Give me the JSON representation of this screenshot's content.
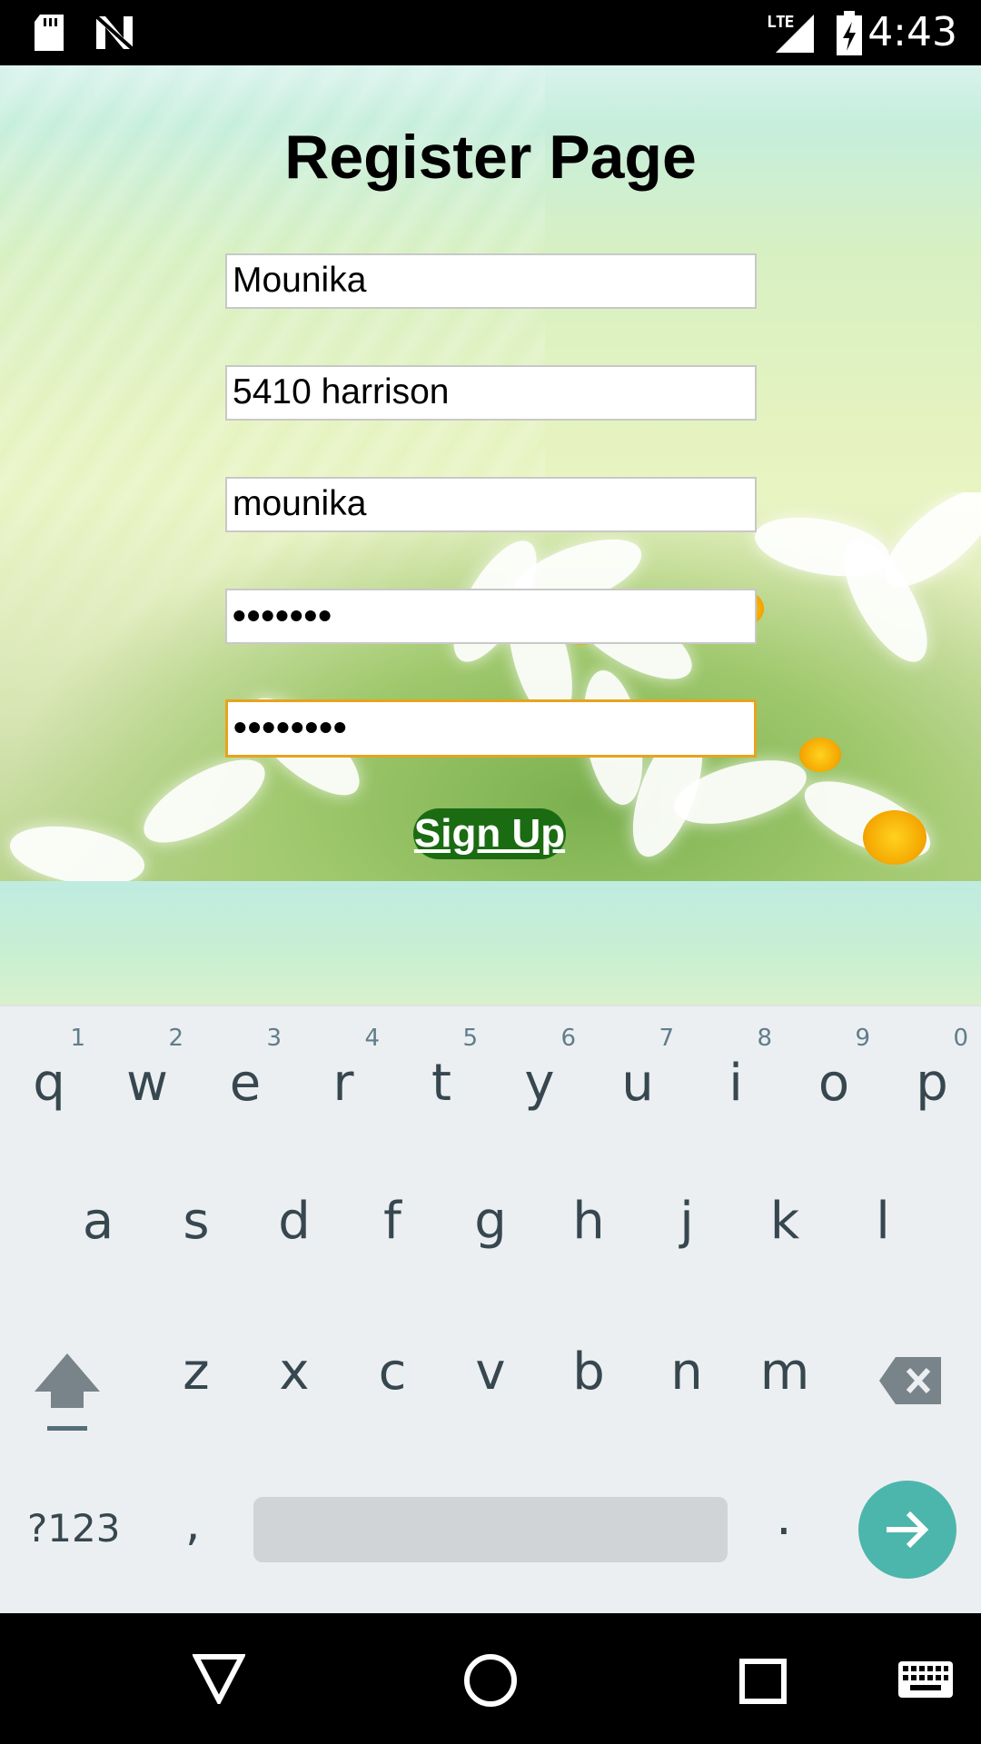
{
  "status_bar": {
    "network_type": "LTE",
    "time": "4:43",
    "icons": [
      "sd-card-icon",
      "n-notification-icon",
      "signal-icon",
      "battery-charging-icon"
    ]
  },
  "page": {
    "title": "Register Page",
    "fields": [
      {
        "name": "full-name-field",
        "value": "Mounika",
        "type": "text"
      },
      {
        "name": "address-field",
        "value": "5410 harrison",
        "type": "text"
      },
      {
        "name": "username-field",
        "value": "mounika",
        "type": "text"
      },
      {
        "name": "password-field",
        "value": "•••••••",
        "type": "password"
      },
      {
        "name": "confirm-password-field",
        "value": "••••••••",
        "type": "password",
        "focused": true
      }
    ],
    "signup_label": "Sign Up",
    "colors": {
      "signup_bg": "#1b6b12",
      "focus_border": "#e8a31c"
    }
  },
  "keyboard": {
    "row1": [
      {
        "letter": "q",
        "hint": "1"
      },
      {
        "letter": "w",
        "hint": "2"
      },
      {
        "letter": "e",
        "hint": "3"
      },
      {
        "letter": "r",
        "hint": "4"
      },
      {
        "letter": "t",
        "hint": "5"
      },
      {
        "letter": "y",
        "hint": "6"
      },
      {
        "letter": "u",
        "hint": "7"
      },
      {
        "letter": "i",
        "hint": "8"
      },
      {
        "letter": "o",
        "hint": "9"
      },
      {
        "letter": "p",
        "hint": "0"
      }
    ],
    "row2": [
      "a",
      "s",
      "d",
      "f",
      "g",
      "h",
      "j",
      "k",
      "l"
    ],
    "row3": [
      "z",
      "x",
      "c",
      "v",
      "b",
      "n",
      "m"
    ],
    "symbols_label": "?123",
    "comma_label": ",",
    "period_label": ".",
    "accent_color": "#4db6ac"
  },
  "nav_bar": {
    "icons": [
      "back-triangle-icon",
      "home-circle-icon",
      "recents-square-icon",
      "keyboard-switch-icon"
    ]
  }
}
